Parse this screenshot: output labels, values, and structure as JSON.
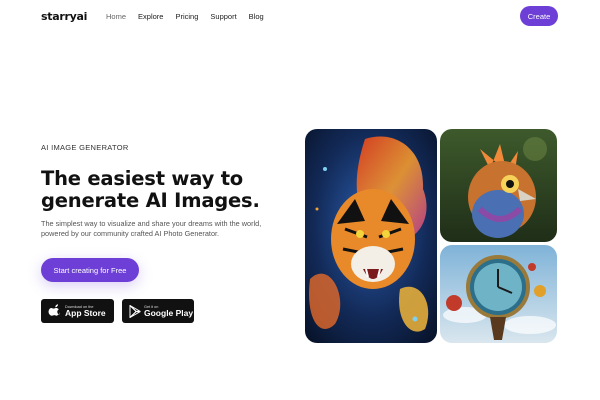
{
  "brand": {
    "logo": "starryai"
  },
  "nav": {
    "items": [
      "Home",
      "Explore",
      "Pricing",
      "Support",
      "Blog"
    ],
    "active": "Home"
  },
  "header": {
    "create_label": "Create"
  },
  "hero": {
    "eyebrow": "AI IMAGE GENERATOR",
    "headline_line1": "The easiest way to",
    "headline_line2": "generate AI Images.",
    "subtext": "The simplest way to visualize and share your dreams with the world, powered by our community crafted AI Photo Generator.",
    "cta_label": "Start creating for Free"
  },
  "stores": {
    "appstore": {
      "small": "Download on the",
      "big": "App Store"
    },
    "googleplay": {
      "small": "Get it on",
      "big": "Google Play"
    }
  },
  "colors": {
    "accent": "#6d3fd6",
    "text": "#111111",
    "store_bg": "#111111"
  },
  "gallery": [
    "tiger-artwork-image",
    "bird-artwork-image",
    "clock-artwork-image"
  ]
}
